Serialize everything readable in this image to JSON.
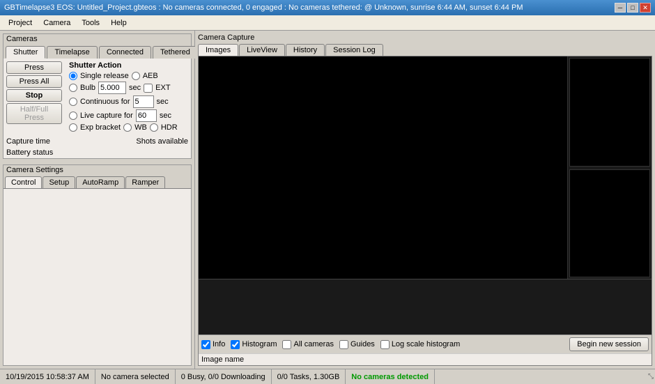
{
  "titlebar": {
    "text": "GBTimelapse3 EOS: Untitled_Project.gbteos : No cameras connected, 0 engaged : No cameras tethered: @ Unknown, sunrise 6:44 AM, sunset 6:44 PM",
    "minimize": "─",
    "maximize": "□",
    "close": "✕"
  },
  "menu": {
    "items": [
      "Project",
      "Camera",
      "Tools",
      "Help"
    ]
  },
  "cameras": {
    "label": "Cameras",
    "tabs": [
      "Shutter",
      "Timelapse",
      "Connected",
      "Tethered"
    ],
    "active_tab": "Shutter",
    "shutter_action_label": "Shutter Action",
    "buttons": {
      "press": "Press",
      "press_all": "Press All",
      "stop": "Stop",
      "half_full": "Half/Full Press"
    },
    "actions": {
      "single_release": "Single release",
      "aeb": "AEB",
      "bulb": "Bulb",
      "bulb_value": "5.000",
      "bulb_unit": "sec",
      "ext_label": "EXT",
      "continuous": "Continuous for",
      "continuous_value": "5",
      "continuous_unit": "sec",
      "live_capture": "Live capture for",
      "live_value": "60",
      "live_unit": "sec",
      "exp_bracket": "Exp bracket",
      "wb": "WB",
      "hdr": "HDR"
    },
    "capture_time_label": "Capture time",
    "battery_label": "Battery status",
    "shots_label": "Shots available"
  },
  "camera_settings": {
    "label": "Camera Settings",
    "tabs": [
      "Control",
      "Setup",
      "AutoRamp",
      "Ramper"
    ],
    "active_tab": "Control"
  },
  "capture": {
    "title": "Camera Capture",
    "tabs": [
      "Images",
      "LiveView",
      "History",
      "Session Log"
    ],
    "active_tab": "Images",
    "controls": {
      "info": "Info",
      "histogram": "Histogram",
      "all_cameras": "All cameras",
      "guides": "Guides",
      "log_scale": "Log scale histogram",
      "begin_session": "Begin new session"
    },
    "image_name_label": "Image name"
  },
  "statusbar": {
    "datetime": "10/19/2015 10:58:37 AM",
    "camera": "No camera selected",
    "busy": "0 Busy, 0/0 Downloading",
    "tasks": "0/0 Tasks, 1.30GB",
    "detected": "No cameras detected"
  }
}
